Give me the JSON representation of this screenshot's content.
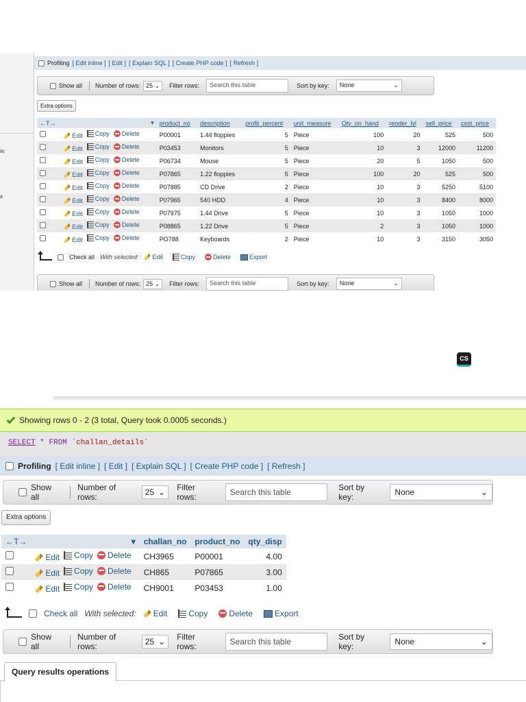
{
  "shot1": {
    "nav_fragments": [
      "ils",
      "a"
    ],
    "profiling": {
      "label": "Profiling",
      "links": [
        "[ Edit inline ]",
        "[ Edit ]",
        "[ Explain SQL ]",
        "[ Create PHP code ]",
        "[ Refresh ]"
      ]
    },
    "navbar": {
      "show_all": "Show all",
      "number_of_rows": "Number of rows:",
      "rows_value": "25",
      "filter_rows": "Filter rows:",
      "search_placeholder": "Search this table",
      "sort_by_key": "Sort by key:",
      "sort_value": "None"
    },
    "extra_options": "Extra options",
    "columns": [
      "product_no",
      "description",
      "profit_percent",
      "unit_measure",
      "Qty_on_hand",
      "reoder_lvl",
      "sell_price",
      "cost_price"
    ],
    "col_arrows": "←T→",
    "actions": {
      "edit": "Edit",
      "copy": "Copy",
      "delete": "Delete"
    },
    "rows": [
      [
        "P00001",
        "1.44 floppies",
        "5",
        "Piece",
        "100",
        "20",
        "525",
        "500"
      ],
      [
        "P03453",
        "Monitors",
        "5",
        "Piece",
        "10",
        "3",
        "12000",
        "11200"
      ],
      [
        "P06734",
        "Mouse",
        "5",
        "Piece",
        "20",
        "5",
        "1050",
        "500"
      ],
      [
        "P07865",
        "1.22 floppies",
        "5",
        "Piece",
        "100",
        "20",
        "525",
        "500"
      ],
      [
        "P07885",
        "CD Drive",
        "2",
        "Piece",
        "10",
        "3",
        "5250",
        "5100"
      ],
      [
        "P07965",
        "540 HDD",
        "4",
        "Piece",
        "10",
        "3",
        "8400",
        "8000"
      ],
      [
        "P07975",
        "1.44 Drive",
        "5",
        "Piece",
        "10",
        "3",
        "1050",
        "1000"
      ],
      [
        "P08865",
        "1.22 Drive",
        "5",
        "Piece",
        "2",
        "3",
        "1050",
        "1000"
      ],
      [
        "PO788",
        "Keyboards",
        "2",
        "Piece",
        "10",
        "3",
        "3150",
        "3050"
      ]
    ],
    "bottom": {
      "check_all": "Check all",
      "with_selected": "With selected:",
      "edit": "Edit",
      "copy": "Copy",
      "delete": "Delete",
      "export": "Export"
    }
  },
  "badge": "CS",
  "shot2": {
    "success": "Showing rows 0 - 2 (3 total, Query took 0.0005 seconds.)",
    "sql": {
      "select": "SELECT",
      "star": " * ",
      "from": "FROM",
      "table": " `challan_details`"
    },
    "profiling": {
      "label": "Profiling",
      "links": [
        "[ Edit inline ]",
        "[ Edit ]",
        "[ Explain SQL ]",
        "[ Create PHP code ]",
        "[ Refresh ]"
      ]
    },
    "navbar": {
      "show_all": "Show all",
      "number_of_rows": "Number of rows:",
      "rows_value": "25",
      "filter_rows": "Filter rows:",
      "search_placeholder": "Search this table",
      "sort_by_key": "Sort by key:",
      "sort_value": "None"
    },
    "extra_options": "Extra options",
    "col_arrows": "←T→",
    "columns": [
      "challan_no",
      "product_no",
      "qty_disp"
    ],
    "actions": {
      "edit": "Edit",
      "copy": "Copy",
      "delete": "Delete"
    },
    "rows": [
      [
        "CH3965",
        "P00001",
        "4.00"
      ],
      [
        "CH865",
        "P07865",
        "3.00"
      ],
      [
        "CH9001",
        "P03453",
        "1.00"
      ]
    ],
    "bottom": {
      "check_all": "Check all",
      "with_selected": "With selected:",
      "edit": "Edit",
      "copy": "Copy",
      "delete": "Delete",
      "export": "Export"
    },
    "query_results_operations": "Query results operations"
  }
}
